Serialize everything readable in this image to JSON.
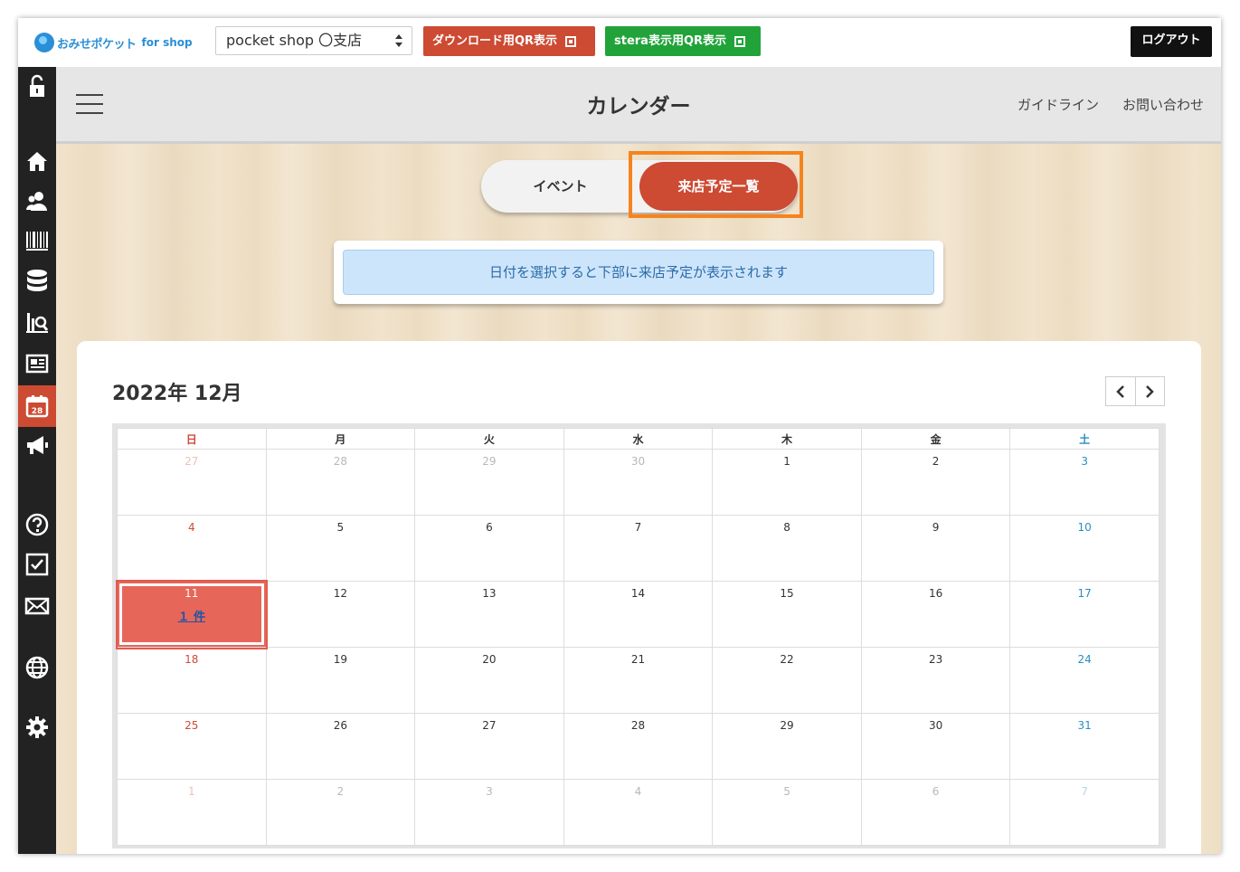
{
  "topbar": {
    "logo_text": "おみせポケット",
    "logo_sub": "for shop",
    "shop_selected": "pocket shop 〇支店",
    "download_qr_label": "ダウンロード用QR表示",
    "stera_qr_label": "stera表示用QR表示",
    "logout_label": "ログアウト"
  },
  "sidebar": {
    "items": [
      "unlock-icon",
      "home-icon",
      "users-icon",
      "barcode-icon",
      "database-icon",
      "analytics-icon",
      "news-icon",
      "calendar-icon",
      "megaphone-icon",
      "help-icon",
      "checkbox-icon",
      "mail-icon",
      "globe-icon",
      "gear-icon"
    ],
    "active": "calendar-icon",
    "calendar_icon_number": "28"
  },
  "header": {
    "title": "カレンダー",
    "guideline_link": "ガイドライン",
    "contact_link": "お問い合わせ"
  },
  "tabs": {
    "event": "イベント",
    "visit_list": "来店予定一覧",
    "active": "visit_list"
  },
  "info_message": "日付を選択すると下部に来店予定が表示されます",
  "calendar": {
    "month_label": "2022年 12月",
    "weekdays": [
      "日",
      "月",
      "火",
      "水",
      "木",
      "金",
      "土"
    ],
    "weeks": [
      [
        "27",
        "28",
        "29",
        "30",
        "1",
        "2",
        "3"
      ],
      [
        "4",
        "5",
        "6",
        "7",
        "8",
        "9",
        "10"
      ],
      [
        "11",
        "12",
        "13",
        "14",
        "15",
        "16",
        "17"
      ],
      [
        "18",
        "19",
        "20",
        "21",
        "22",
        "23",
        "24"
      ],
      [
        "25",
        "26",
        "27",
        "28",
        "29",
        "30",
        "31"
      ],
      [
        "1",
        "2",
        "3",
        "4",
        "5",
        "6",
        "7"
      ]
    ],
    "selected_date": "11",
    "selected_count_label": "１ 件"
  },
  "colors": {
    "accent": "#cd4a33",
    "stera_green": "#21a33a",
    "highlight_orange": "#f5841f",
    "selected_cell": "#e7665a",
    "sunday": "#d04a3a",
    "saturday": "#2a8fbf"
  }
}
